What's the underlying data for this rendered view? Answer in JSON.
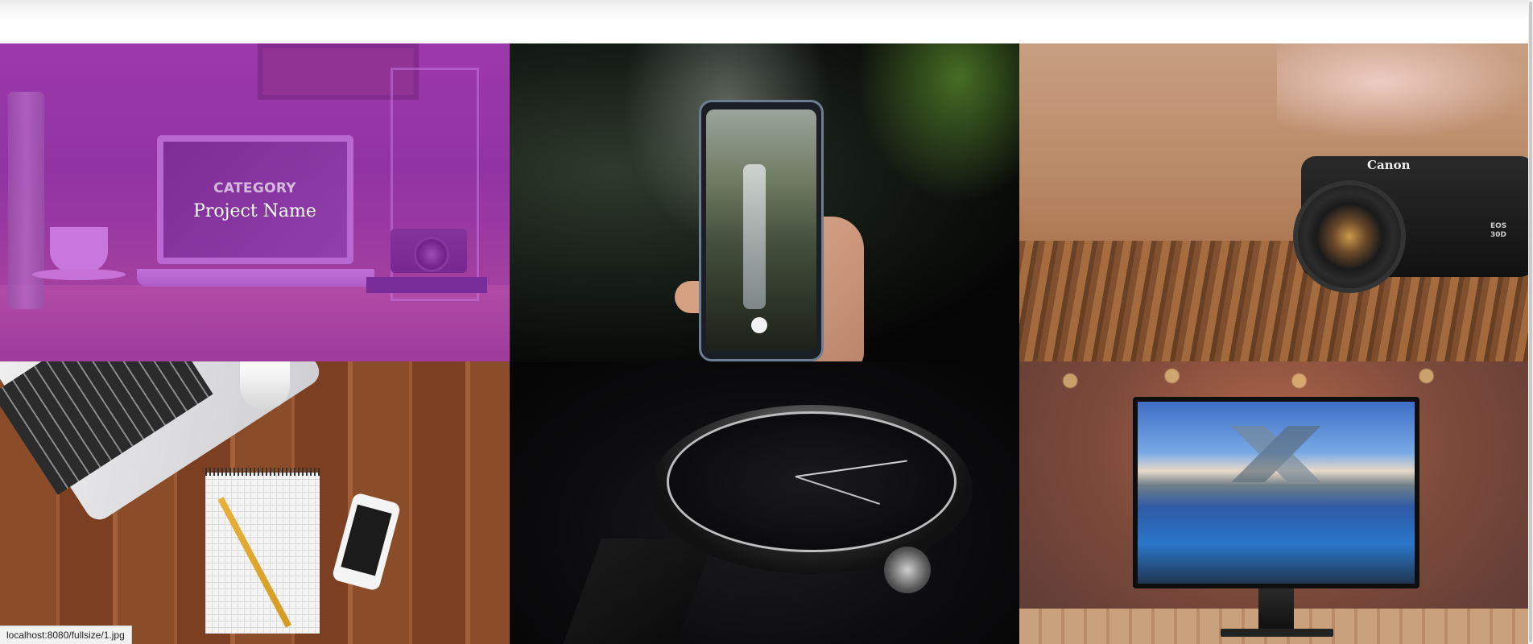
{
  "overlay": {
    "category": "CATEGORY",
    "project_name": "Project Name"
  },
  "status_bar": {
    "url": "localhost:8080/fullsize/1.jpg"
  },
  "tiles": [
    {
      "icon": "laptop-cafe-image"
    },
    {
      "icon": "phone-waterfall-image"
    },
    {
      "icon": "canon-camera-image"
    },
    {
      "icon": "desk-laptop-notepad-image"
    },
    {
      "icon": "watch-image"
    },
    {
      "icon": "monitor-image"
    }
  ],
  "camera": {
    "brand": "Canon",
    "model_line1": "EOS",
    "model_line2": "30D"
  },
  "colors": {
    "overlay_purple": "#b12fd6"
  }
}
